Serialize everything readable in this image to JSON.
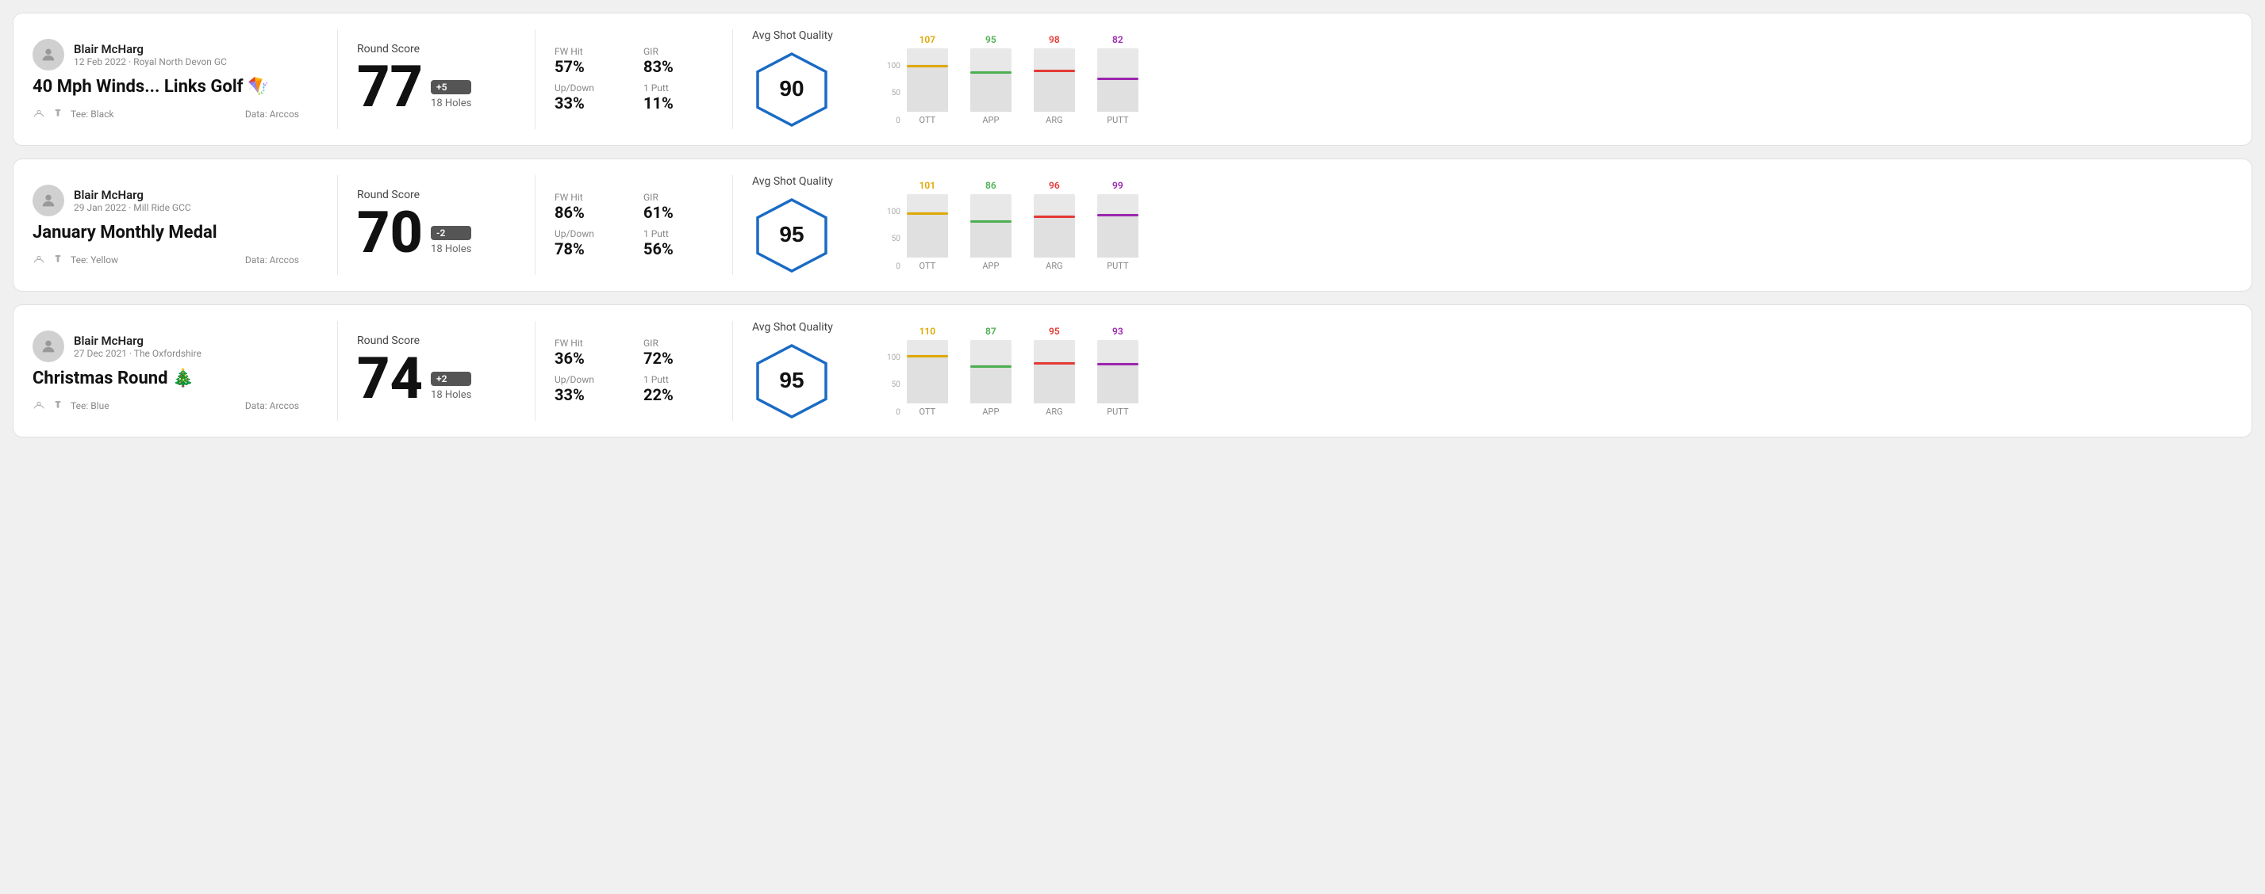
{
  "rounds": [
    {
      "id": "round-1",
      "user": {
        "name": "Blair McHarg",
        "meta": "12 Feb 2022 · Royal North Devon GC"
      },
      "title": "40 Mph Winds... Links Golf 🪁",
      "tee": "Black",
      "data_source": "Arccos",
      "score": {
        "value": "77",
        "badge": "+5",
        "holes": "18 Holes"
      },
      "stats": {
        "fw_hit_label": "FW Hit",
        "fw_hit_value": "57%",
        "gir_label": "GIR",
        "gir_value": "83%",
        "updown_label": "Up/Down",
        "updown_value": "33%",
        "oneputt_label": "1 Putt",
        "oneputt_value": "11%"
      },
      "quality": {
        "label": "Avg Shot Quality",
        "score": "90"
      },
      "chart": {
        "bars": [
          {
            "label": "OTT",
            "top_val": "107",
            "top_color": "#e0a800",
            "bar_pct": 75,
            "line_pct": 85
          },
          {
            "label": "APP",
            "top_val": "95",
            "top_color": "#4caf50",
            "bar_pct": 65,
            "line_pct": 75
          },
          {
            "label": "ARG",
            "top_val": "98",
            "top_color": "#e53935",
            "bar_pct": 68,
            "line_pct": 78
          },
          {
            "label": "PUTT",
            "top_val": "82",
            "top_color": "#9c27b0",
            "bar_pct": 55,
            "line_pct": 65
          }
        ],
        "y_labels": [
          "100",
          "50",
          "0"
        ]
      }
    },
    {
      "id": "round-2",
      "user": {
        "name": "Blair McHarg",
        "meta": "29 Jan 2022 · Mill Ride GCC"
      },
      "title": "January Monthly Medal",
      "tee": "Yellow",
      "data_source": "Arccos",
      "score": {
        "value": "70",
        "badge": "-2",
        "holes": "18 Holes"
      },
      "stats": {
        "fw_hit_label": "FW Hit",
        "fw_hit_value": "86%",
        "gir_label": "GIR",
        "gir_value": "61%",
        "updown_label": "Up/Down",
        "updown_value": "78%",
        "oneputt_label": "1 Putt",
        "oneputt_value": "56%"
      },
      "quality": {
        "label": "Avg Shot Quality",
        "score": "95"
      },
      "chart": {
        "bars": [
          {
            "label": "OTT",
            "top_val": "101",
            "top_color": "#e0a800",
            "bar_pct": 72,
            "line_pct": 80
          },
          {
            "label": "APP",
            "top_val": "86",
            "top_color": "#4caf50",
            "bar_pct": 60,
            "line_pct": 68
          },
          {
            "label": "ARG",
            "top_val": "96",
            "top_color": "#e53935",
            "bar_pct": 67,
            "line_pct": 76
          },
          {
            "label": "PUTT",
            "top_val": "99",
            "top_color": "#9c27b0",
            "bar_pct": 70,
            "line_pct": 78
          }
        ],
        "y_labels": [
          "100",
          "50",
          "0"
        ]
      }
    },
    {
      "id": "round-3",
      "user": {
        "name": "Blair McHarg",
        "meta": "27 Dec 2021 · The Oxfordshire"
      },
      "title": "Christmas Round 🎄",
      "tee": "Blue",
      "data_source": "Arccos",
      "score": {
        "value": "74",
        "badge": "+2",
        "holes": "18 Holes"
      },
      "stats": {
        "fw_hit_label": "FW Hit",
        "fw_hit_value": "36%",
        "gir_label": "GIR",
        "gir_value": "72%",
        "updown_label": "Up/Down",
        "updown_value": "33%",
        "oneputt_label": "1 Putt",
        "oneputt_value": "22%"
      },
      "quality": {
        "label": "Avg Shot Quality",
        "score": "95"
      },
      "chart": {
        "bars": [
          {
            "label": "OTT",
            "top_val": "110",
            "top_color": "#e0a800",
            "bar_pct": 78,
            "line_pct": 88
          },
          {
            "label": "APP",
            "top_val": "87",
            "top_color": "#4caf50",
            "bar_pct": 61,
            "line_pct": 69
          },
          {
            "label": "ARG",
            "top_val": "95",
            "top_color": "#e53935",
            "bar_pct": 66,
            "line_pct": 75
          },
          {
            "label": "PUTT",
            "top_val": "93",
            "top_color": "#9c27b0",
            "bar_pct": 65,
            "line_pct": 73
          }
        ],
        "y_labels": [
          "100",
          "50",
          "0"
        ]
      }
    }
  ],
  "labels": {
    "round_score": "Round Score",
    "avg_shot_quality": "Avg Shot Quality",
    "tee_prefix": "Tee:",
    "data_prefix": "Data:"
  }
}
